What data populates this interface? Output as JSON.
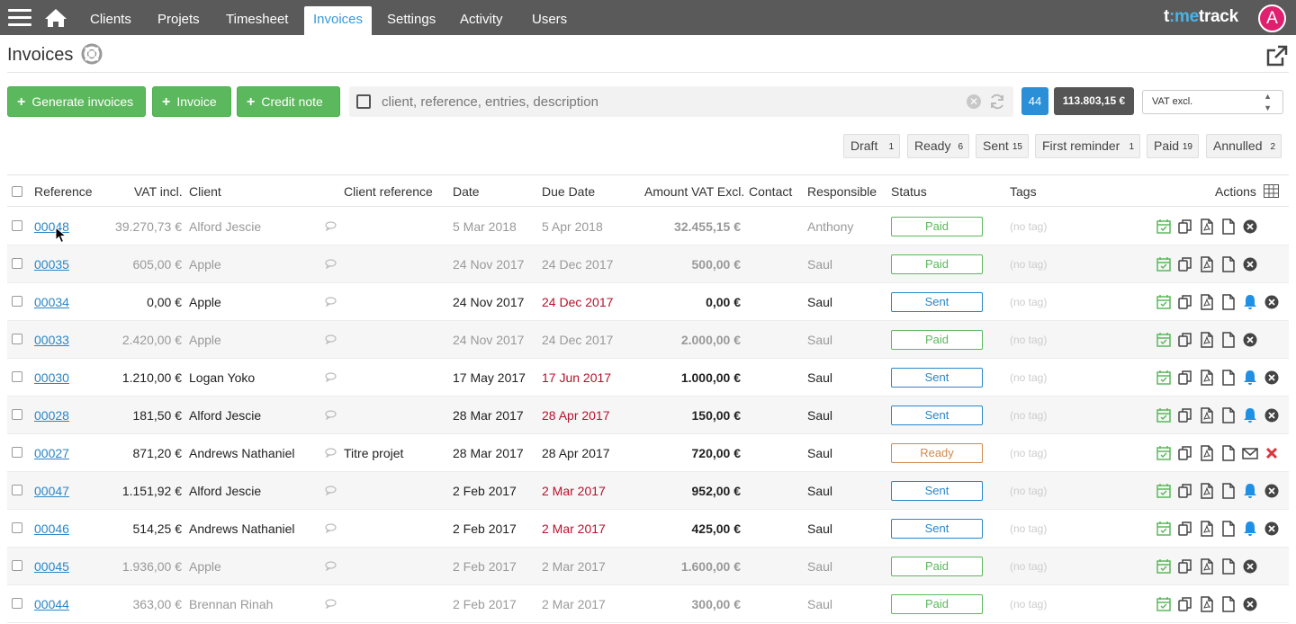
{
  "nav": {
    "tabs": [
      "Clients",
      "Projets",
      "Timesheet",
      "Invoices",
      "Settings",
      "Activity",
      "Users"
    ],
    "active": "Invoices",
    "brand_pre": "t",
    "brand_mid": ":me",
    "brand_post": "track",
    "avatar": "A"
  },
  "page": {
    "title": "Invoices"
  },
  "toolbar": {
    "generate_label": "Generate invoices",
    "invoice_label": "Invoice",
    "credit_label": "Credit note",
    "search_placeholder": "client, reference, entries, description",
    "count": "44",
    "total": "113.803,15 €",
    "vat_mode": "VAT excl."
  },
  "filters": [
    {
      "label": "Draft",
      "count": "1"
    },
    {
      "label": "Ready",
      "count": "6"
    },
    {
      "label": "Sent",
      "count": "15"
    },
    {
      "label": "First reminder",
      "count": "1"
    },
    {
      "label": "Paid",
      "count": "19"
    },
    {
      "label": "Annulled",
      "count": "2"
    }
  ],
  "columns": [
    "Reference",
    "VAT incl.",
    "Client",
    "Client reference",
    "Date",
    "Due Date",
    "Amount VAT Excl.",
    "Contact",
    "Responsible",
    "Status",
    "Tags",
    "Actions"
  ],
  "rows": [
    {
      "ref": "00048",
      "vat_incl": "39.270,73 €",
      "client": "Alford Jescie",
      "client_ref": "",
      "date": "5 Mar 2018",
      "due": "5 Apr 2018",
      "amount": "32.455,15 €",
      "responsible": "Anthony",
      "status": "Paid",
      "tag": "(no tag)",
      "overdue": false
    },
    {
      "ref": "00035",
      "vat_incl": "605,00 €",
      "client": "Apple",
      "client_ref": "",
      "date": "24 Nov 2017",
      "due": "24 Dec 2017",
      "amount": "500,00 €",
      "responsible": "Saul",
      "status": "Paid",
      "tag": "(no tag)",
      "overdue": false
    },
    {
      "ref": "00034",
      "vat_incl": "0,00 €",
      "client": "Apple",
      "client_ref": "",
      "date": "24 Nov 2017",
      "due": "24 Dec 2017",
      "amount": "0,00 €",
      "responsible": "Saul",
      "status": "Sent",
      "tag": "(no tag)",
      "overdue": true
    },
    {
      "ref": "00033",
      "vat_incl": "2.420,00 €",
      "client": "Apple",
      "client_ref": "",
      "date": "24 Nov 2017",
      "due": "24 Dec 2017",
      "amount": "2.000,00 €",
      "responsible": "Saul",
      "status": "Paid",
      "tag": "(no tag)",
      "overdue": false
    },
    {
      "ref": "00030",
      "vat_incl": "1.210,00 €",
      "client": "Logan Yoko",
      "client_ref": "",
      "date": "17 May 2017",
      "due": "17 Jun 2017",
      "amount": "1.000,00 €",
      "responsible": "Saul",
      "status": "Sent",
      "tag": "(no tag)",
      "overdue": true
    },
    {
      "ref": "00028",
      "vat_incl": "181,50 €",
      "client": "Alford Jescie",
      "client_ref": "",
      "date": "28 Mar 2017",
      "due": "28 Apr 2017",
      "amount": "150,00 €",
      "responsible": "Saul",
      "status": "Sent",
      "tag": "(no tag)",
      "overdue": true
    },
    {
      "ref": "00027",
      "vat_incl": "871,20 €",
      "client": "Andrews Nathaniel",
      "client_ref": "Titre projet",
      "date": "28 Mar 2017",
      "due": "28 Apr 2017",
      "amount": "720,00 €",
      "responsible": "Saul",
      "status": "Ready",
      "tag": "(no tag)",
      "overdue": false
    },
    {
      "ref": "00047",
      "vat_incl": "1.151,92 €",
      "client": "Alford Jescie",
      "client_ref": "",
      "date": "2 Feb 2017",
      "due": "2 Mar 2017",
      "amount": "952,00 €",
      "responsible": "Saul",
      "status": "Sent",
      "tag": "(no tag)",
      "overdue": true
    },
    {
      "ref": "00046",
      "vat_incl": "514,25 €",
      "client": "Andrews Nathaniel",
      "client_ref": "",
      "date": "2 Feb 2017",
      "due": "2 Mar 2017",
      "amount": "425,00 €",
      "responsible": "Saul",
      "status": "Sent",
      "tag": "(no tag)",
      "overdue": true
    },
    {
      "ref": "00045",
      "vat_incl": "1.936,00 €",
      "client": "Apple",
      "client_ref": "",
      "date": "2 Feb 2017",
      "due": "2 Mar 2017",
      "amount": "1.600,00 €",
      "responsible": "Saul",
      "status": "Paid",
      "tag": "(no tag)",
      "overdue": false
    },
    {
      "ref": "00044",
      "vat_incl": "363,00 €",
      "client": "Brennan Rinah",
      "client_ref": "",
      "date": "2 Feb 2017",
      "due": "2 Mar 2017",
      "amount": "300,00 €",
      "responsible": "Saul",
      "status": "Paid",
      "tag": "(no tag)",
      "overdue": false
    }
  ],
  "colors": {
    "nav_bg": "#5a5a5a",
    "accent": "#2a86c6",
    "paid": "#5cb85c",
    "ready": "#d08a50",
    "overdue": "#b8102c",
    "bell": "#1e90e6"
  }
}
